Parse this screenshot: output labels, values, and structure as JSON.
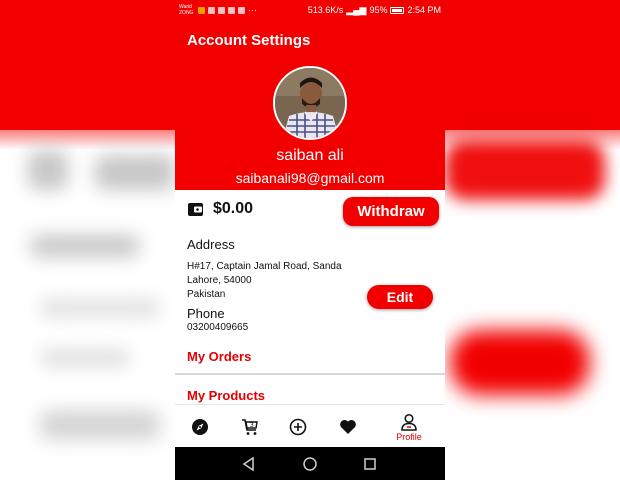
{
  "status_bar": {
    "carrier_line1": "Warid",
    "carrier_line2": "ZONG",
    "net_speed": "513.6K/s",
    "battery": "95%",
    "time": "2:54 PM"
  },
  "header": {
    "title": "Account Settings",
    "user_name": "saiban ali",
    "user_email": "saibanali98@gmail.com"
  },
  "wallet": {
    "balance": "$0.00",
    "withdraw_label": "Withdraw"
  },
  "address": {
    "label": "Address",
    "lines": [
      "H#17, Captain Jamal Road, Sanda",
      "Lahore, 54000",
      "Pakistan"
    ],
    "edit_label": "Edit"
  },
  "phone": {
    "label": "Phone",
    "value": "03200409665"
  },
  "sections": {
    "orders": "My Orders",
    "products": "My Products"
  },
  "bottom_nav": {
    "items": [
      {
        "icon": "compass-icon",
        "label": ""
      },
      {
        "icon": "cart-icon",
        "label": ""
      },
      {
        "icon": "add-circle-icon",
        "label": ""
      },
      {
        "icon": "heart-icon",
        "label": ""
      },
      {
        "icon": "profile-icon",
        "label": "Profile"
      }
    ]
  },
  "colors": {
    "accent": "#f20000",
    "link": "#e30000",
    "system_bar": "#000000"
  }
}
